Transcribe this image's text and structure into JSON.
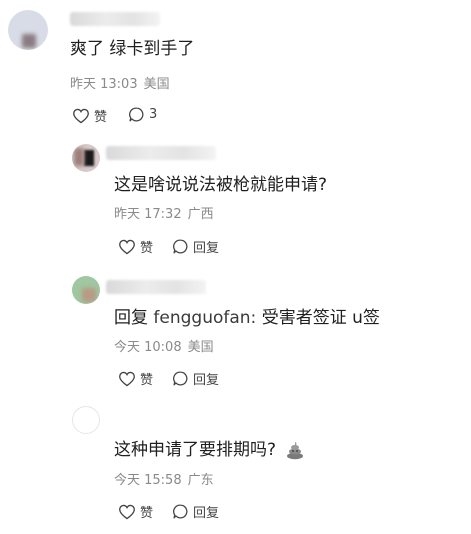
{
  "comments": [
    {
      "text": "爽了 绿卡到手了",
      "time": "昨天 13:03",
      "location": "美国",
      "like_label": "赞",
      "reply_count": "3"
    },
    {
      "text": "这是啥说说法被枪就能申请?",
      "time": "昨天 17:32",
      "location": "广西",
      "like_label": "赞",
      "reply_label": "回复"
    },
    {
      "reply_prefix": "回复",
      "mention": "fengguofan:",
      "text": "受害者签证 u签",
      "time": "今天 10:08",
      "location": "美国",
      "like_label": "赞",
      "reply_label": "回复"
    },
    {
      "text": "这种申请了要排期吗?",
      "emoji": "💩",
      "time": "今天 15:58",
      "location": "广东",
      "like_label": "赞",
      "reply_label": "回复"
    }
  ]
}
